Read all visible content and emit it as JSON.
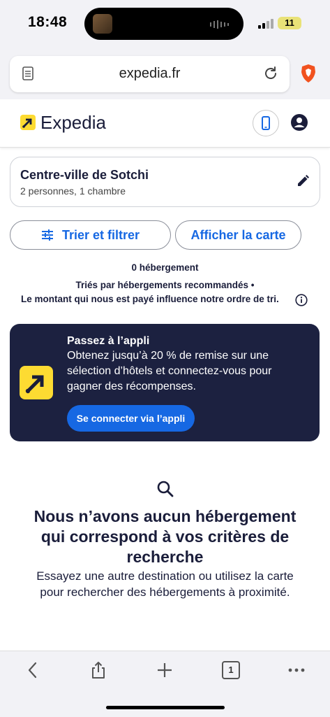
{
  "status_bar": {
    "time": "18:48",
    "battery": "11"
  },
  "browser": {
    "url": "expedia.fr"
  },
  "header": {
    "brand": "Expedia"
  },
  "search": {
    "destination": "Centre-ville de Sotchi",
    "guests": "2 personnes, 1 chambre"
  },
  "actions": {
    "sort_filter_label": "Trier et filtrer",
    "map_label": "Afficher la carte"
  },
  "results": {
    "count": "0 hébergement",
    "sorted_by": "Triés par hébergements recommandés •",
    "influence": "Le montant qui nous est payé influence notre ordre de tri."
  },
  "app_banner": {
    "title": "Passez à l’appli",
    "text": "Obtenez jusqu’à 20 % de remise sur une sélection d’hôtels et connectez-vous pour gagner des récompenses.",
    "button": "Se connecter via l’appli"
  },
  "empty_state": {
    "title": "Nous n’avons aucun hébergement qui correspond à vos critères de recherche",
    "text": "Essayez une autre destination ou utilisez la carte pour rechercher des hébergements à proximité."
  },
  "toolbar": {
    "tab_count": "1"
  },
  "colors": {
    "accent": "#1668e3",
    "brand_yellow": "#fddb32",
    "banner_bg": "#1c2140"
  }
}
